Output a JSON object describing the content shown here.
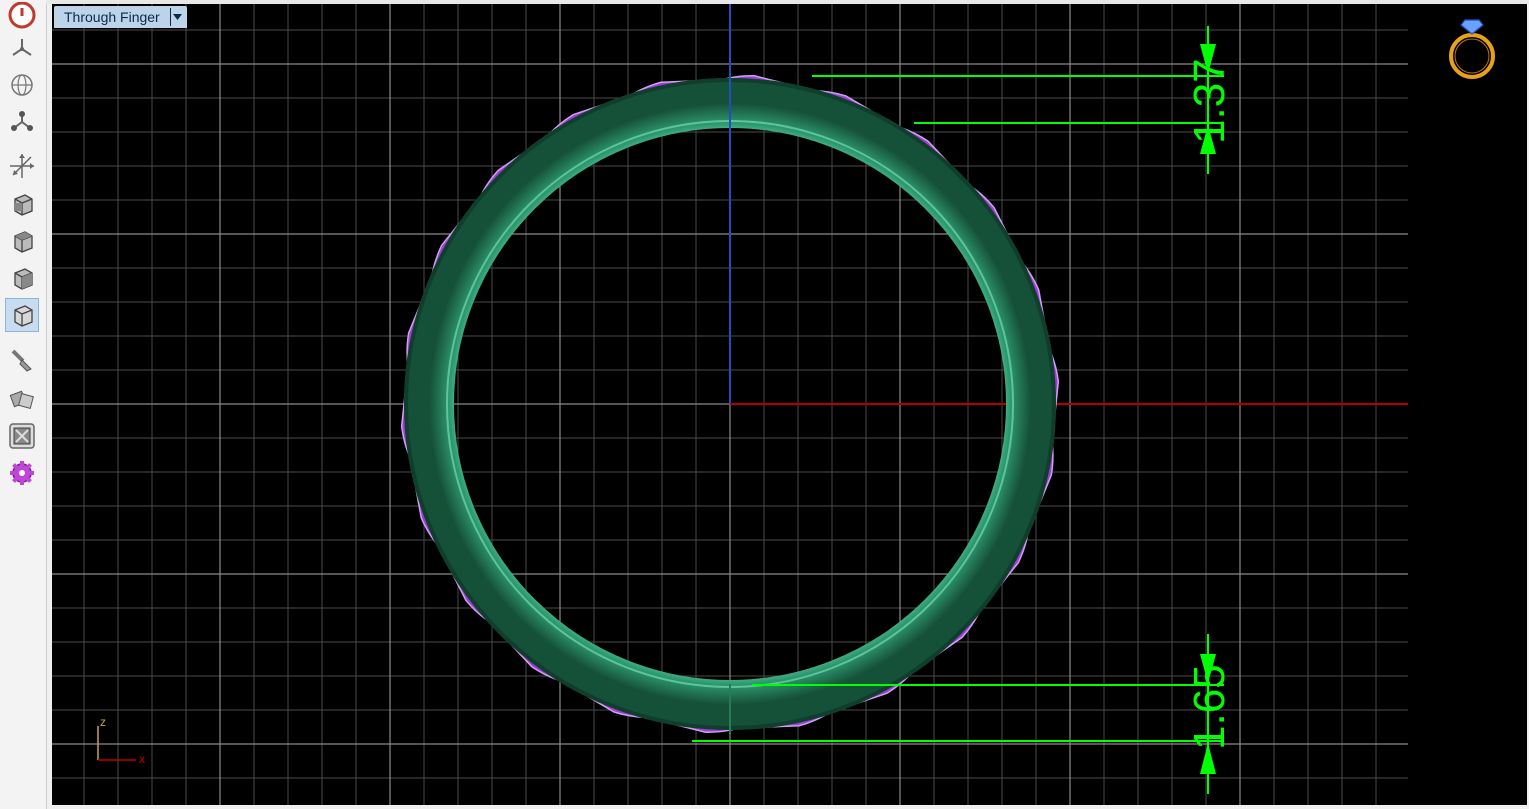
{
  "viewport": {
    "view_name": "Through Finger",
    "dropdown_icon": "chevron-down-icon"
  },
  "dimensions": {
    "top_thickness": "1.37",
    "bottom_thickness": "1.65"
  },
  "axis_indicator": {
    "z_label": "z",
    "x_label": "x"
  },
  "toolbar": {
    "items": [
      {
        "icon": "power-icon"
      },
      {
        "icon": "rotate-view-icon"
      },
      {
        "icon": "globe-icon"
      },
      {
        "icon": "nodes-icon"
      },
      {
        "icon": "axes-move-icon"
      },
      {
        "icon": "cube-front-view-icon"
      },
      {
        "icon": "cube-top-view-icon"
      },
      {
        "icon": "cube-side-view-icon"
      },
      {
        "icon": "cube-perspective-view-icon"
      },
      {
        "icon": "brush-tool-icon"
      },
      {
        "icon": "shapes-tool-icon"
      },
      {
        "icon": "render-frame-icon"
      },
      {
        "icon": "settings-gear-icon"
      }
    ]
  },
  "colors": {
    "band": "#2e9a70",
    "gems": "#9a3fd2",
    "dimension_lines": "#00ff00",
    "x_axis": "#b00000",
    "z_axis": "#2050c0",
    "ring_logo": "#e7a21a"
  }
}
